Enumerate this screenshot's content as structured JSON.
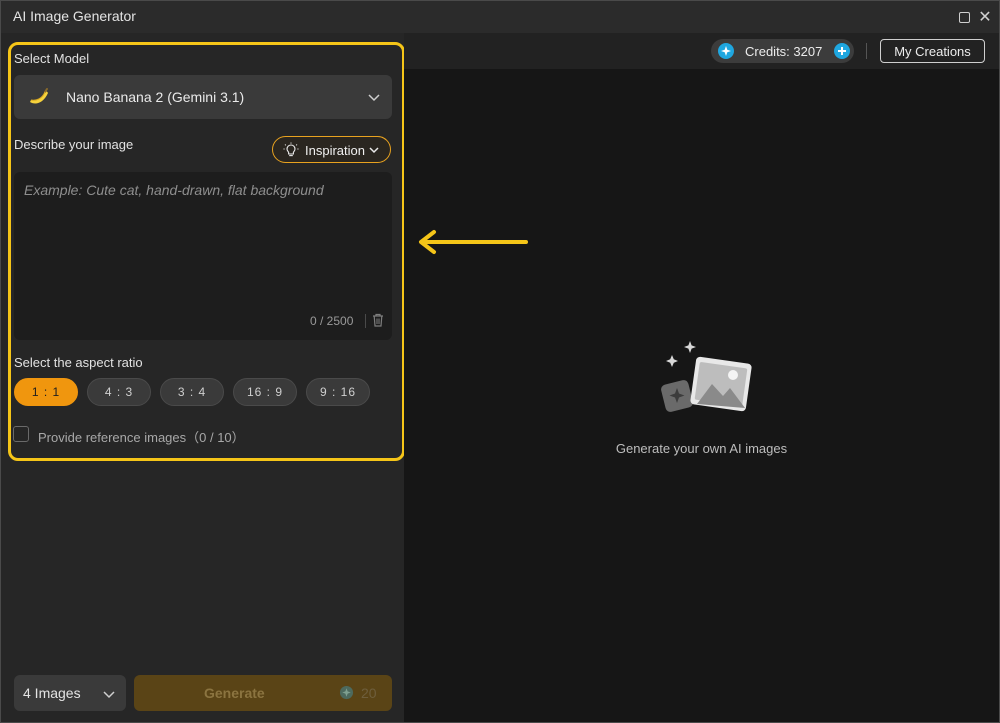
{
  "window": {
    "title": "AI Image Generator"
  },
  "model": {
    "label": "Select Model",
    "selected": "Nano Banana 2 (Gemini 3.1)"
  },
  "prompt": {
    "label": "Describe your image",
    "inspiration_label": "Inspiration",
    "placeholder": "Example: Cute cat, hand-drawn, flat background",
    "value": "",
    "counter": "0 / 2500"
  },
  "aspect": {
    "label": "Select the aspect ratio",
    "options": [
      "1 : 1",
      "4 : 3",
      "3 : 4",
      "16 : 9",
      "9 : 16"
    ],
    "selected_index": 0
  },
  "reference": {
    "label": "Provide reference images（0 / 10）",
    "checked": false
  },
  "footer": {
    "count_selected": "4 Images",
    "generate_label": "Generate",
    "generate_cost": "20"
  },
  "header": {
    "credits": "Credits: 3207",
    "my_creations": "My Creations"
  },
  "empty_state": {
    "text": "Generate your own AI images"
  },
  "colors": {
    "accent": "#f0960e",
    "highlight": "#f5c518",
    "credits_icon": "#1fa7e0"
  }
}
